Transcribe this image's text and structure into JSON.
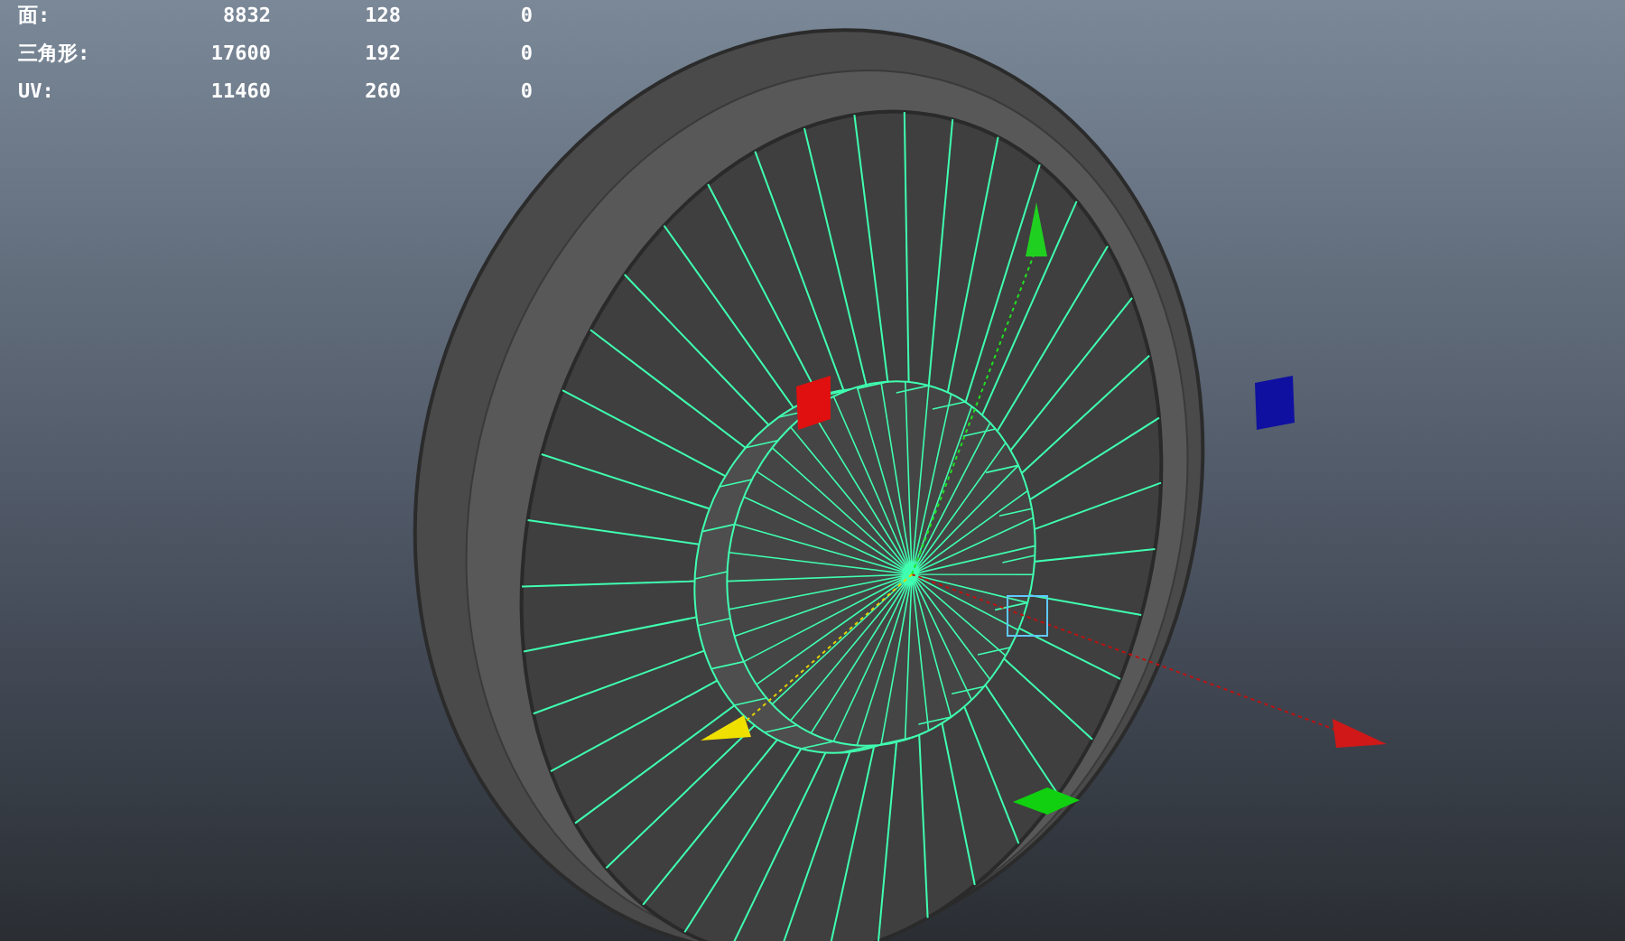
{
  "stats": [
    {
      "label": "面:",
      "values": [
        "8832",
        "128",
        "0"
      ]
    },
    {
      "label": "三角形:",
      "values": [
        "17600",
        "192",
        "0"
      ]
    },
    {
      "label": "UV:",
      "values": [
        "11460",
        "260",
        "0"
      ]
    }
  ]
}
